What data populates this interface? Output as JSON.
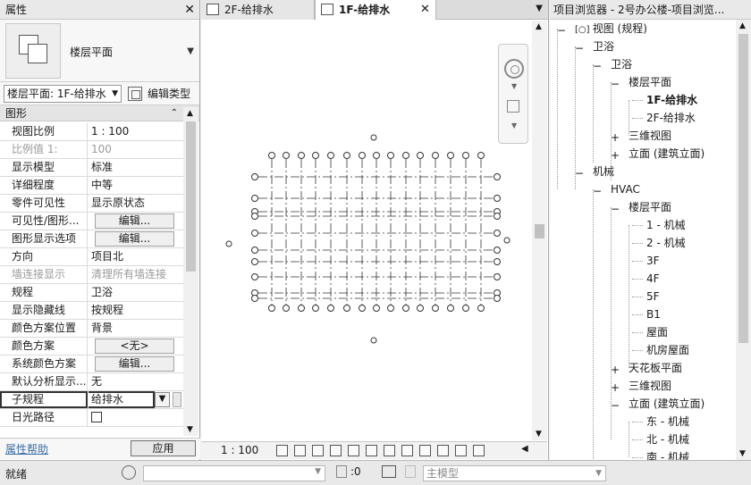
{
  "properties": {
    "title": "属性",
    "type_name": "楼层平面",
    "type_selector": "楼层平面: 1F-给排水",
    "edit_type_label": "编辑类型",
    "category": "图形",
    "rows": [
      {
        "label": "视图比例",
        "value": "1 : 100"
      },
      {
        "label": "比例值 1:",
        "value": "100"
      },
      {
        "label": "显示模型",
        "value": "标准"
      },
      {
        "label": "详细程度",
        "value": "中等"
      },
      {
        "label": "零件可见性",
        "value": "显示原状态"
      },
      {
        "label": "可见性/图形...",
        "value": "编辑..."
      },
      {
        "label": "图形显示选项",
        "value": "编辑..."
      },
      {
        "label": "方向",
        "value": "项目北"
      },
      {
        "label": "墙连接显示",
        "value": "清理所有墙连接"
      },
      {
        "label": "规程",
        "value": "卫浴"
      },
      {
        "label": "显示隐藏线",
        "value": "按规程"
      },
      {
        "label": "颜色方案位置",
        "value": "背景"
      },
      {
        "label": "颜色方案",
        "value": "<无>"
      },
      {
        "label": "系统颜色方案",
        "value": "编辑..."
      },
      {
        "label": "默认分析显示...",
        "value": "无"
      },
      {
        "label": "子规程",
        "value": "给排水"
      },
      {
        "label": "日光路径",
        "value": ""
      }
    ],
    "help_link": "属性帮助",
    "apply_button": "应用"
  },
  "view": {
    "tabs": [
      {
        "label": "2F-给排水",
        "active": false
      },
      {
        "label": "1F-给排水",
        "active": true
      }
    ],
    "scale": "1 : 100"
  },
  "browser": {
    "title": "项目浏览器 - 2号办公楼-项目浏览...",
    "nodes": [
      {
        "label": "视图 (规程)",
        "level": 0,
        "toggle": "-"
      },
      {
        "label": "卫浴",
        "level": 1,
        "toggle": "-"
      },
      {
        "label": "卫浴",
        "level": 2,
        "toggle": "-"
      },
      {
        "label": "楼层平面",
        "level": 3,
        "toggle": "-"
      },
      {
        "label": "1F-给排水",
        "level": 4,
        "toggle": "",
        "selected": true
      },
      {
        "label": "2F-给排水",
        "level": 4,
        "toggle": ""
      },
      {
        "label": "三维视图",
        "level": 3,
        "toggle": "+"
      },
      {
        "label": "立面 (建筑立面)",
        "level": 3,
        "toggle": "+"
      },
      {
        "label": "机械",
        "level": 1,
        "toggle": "-"
      },
      {
        "label": "HVAC",
        "level": 2,
        "toggle": "-"
      },
      {
        "label": "楼层平面",
        "level": 3,
        "toggle": "-"
      },
      {
        "label": "1 - 机械",
        "level": 4,
        "toggle": ""
      },
      {
        "label": "2 - 机械",
        "level": 4,
        "toggle": ""
      },
      {
        "label": "3F",
        "level": 4,
        "toggle": ""
      },
      {
        "label": "4F",
        "level": 4,
        "toggle": ""
      },
      {
        "label": "5F",
        "level": 4,
        "toggle": ""
      },
      {
        "label": "B1",
        "level": 4,
        "toggle": ""
      },
      {
        "label": "屋面",
        "level": 4,
        "toggle": ""
      },
      {
        "label": "机房屋面",
        "level": 4,
        "toggle": ""
      },
      {
        "label": "天花板平面",
        "level": 3,
        "toggle": "+"
      },
      {
        "label": "三维视图",
        "level": 3,
        "toggle": "+"
      },
      {
        "label": "立面 (建筑立面)",
        "level": 3,
        "toggle": "-"
      },
      {
        "label": "东 - 机械",
        "level": 4,
        "toggle": ""
      },
      {
        "label": "北 - 机械",
        "level": 4,
        "toggle": ""
      },
      {
        "label": "南 - 机械",
        "level": 4,
        "toggle": ""
      }
    ]
  },
  "status": {
    "ready": "就绪",
    "edit_requests": ":0",
    "model": "主模型"
  }
}
